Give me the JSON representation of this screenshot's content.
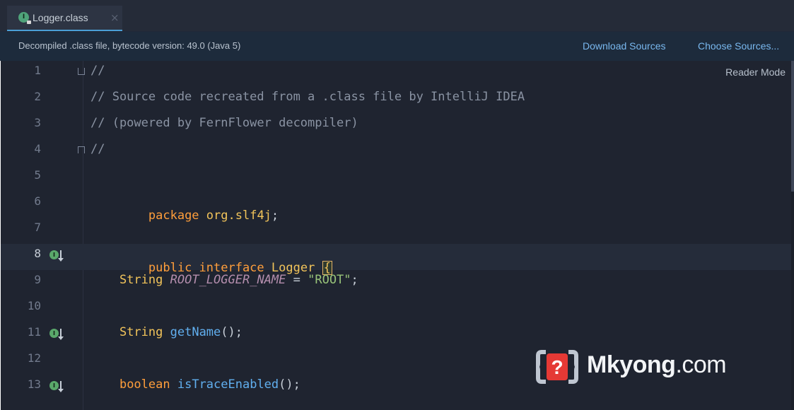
{
  "tab": {
    "label": "Logger.class",
    "icon_letter": "I",
    "close": "×"
  },
  "banner": {
    "message": "Decompiled .class file, bytecode version: 49.0 (Java 5)",
    "download_sources": "Download Sources",
    "choose_sources": "Choose Sources..."
  },
  "editor": {
    "reader_mode": "Reader Mode",
    "line_numbers": [
      "1",
      "2",
      "3",
      "4",
      "5",
      "6",
      "7",
      "8",
      "9",
      "10",
      "11",
      "12",
      "13"
    ],
    "lines": [
      "//",
      "// Source code recreated from a .class file by IntelliJ IDEA",
      "// (powered by FernFlower decompiler)",
      "//",
      "",
      "package org.slf4j;",
      "",
      "public interface Logger {",
      "    String ROOT_LOGGER_NAME = \"ROOT\";",
      "",
      "    String getName();",
      "",
      "    boolean isTraceEnabled();"
    ],
    "markers": [
      "8",
      "11",
      "13"
    ]
  },
  "watermark": {
    "brand": "Mkyong",
    "domain": ".com",
    "question_mark": "?"
  },
  "colors": {
    "keyword": "#ff9e3b",
    "type": "#f2c45a",
    "constant": "#b48ead",
    "string": "#98c379",
    "comment": "#8a93a3",
    "method": "#61afef",
    "background": "#1f2430"
  }
}
